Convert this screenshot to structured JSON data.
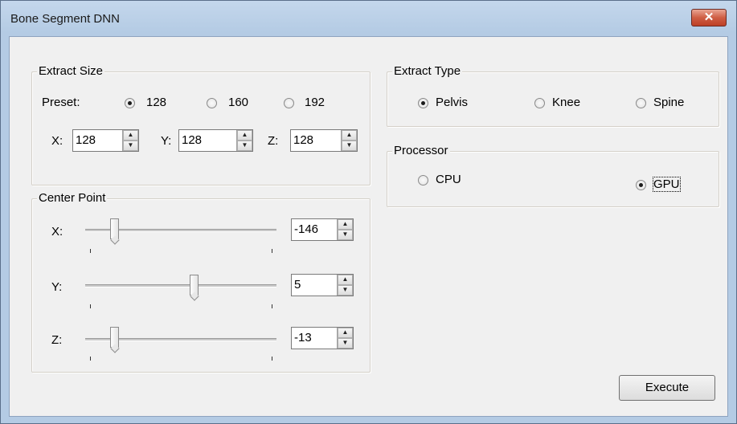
{
  "window": {
    "title": "Bone Segment DNN",
    "close_label": "✕"
  },
  "extract_size": {
    "title": "Extract Size",
    "preset_label": "Preset:",
    "presets": [
      "128",
      "160",
      "192"
    ],
    "selected_preset": "128",
    "x_label": "X:",
    "x_value": "128",
    "y_label": "Y:",
    "y_value": "128",
    "z_label": "Z:",
    "z_value": "128"
  },
  "center_point": {
    "title": "Center Point",
    "x_label": "X:",
    "x_value": "-146",
    "y_label": "Y:",
    "y_value": "5",
    "z_label": "Z:",
    "z_value": "-13"
  },
  "extract_type": {
    "title": "Extract Type",
    "options": [
      "Pelvis",
      "Knee",
      "Spine"
    ],
    "selected": "Pelvis"
  },
  "processor": {
    "title": "Processor",
    "options": [
      "CPU",
      "GPU"
    ],
    "selected": "GPU"
  },
  "execute_label": "Execute"
}
